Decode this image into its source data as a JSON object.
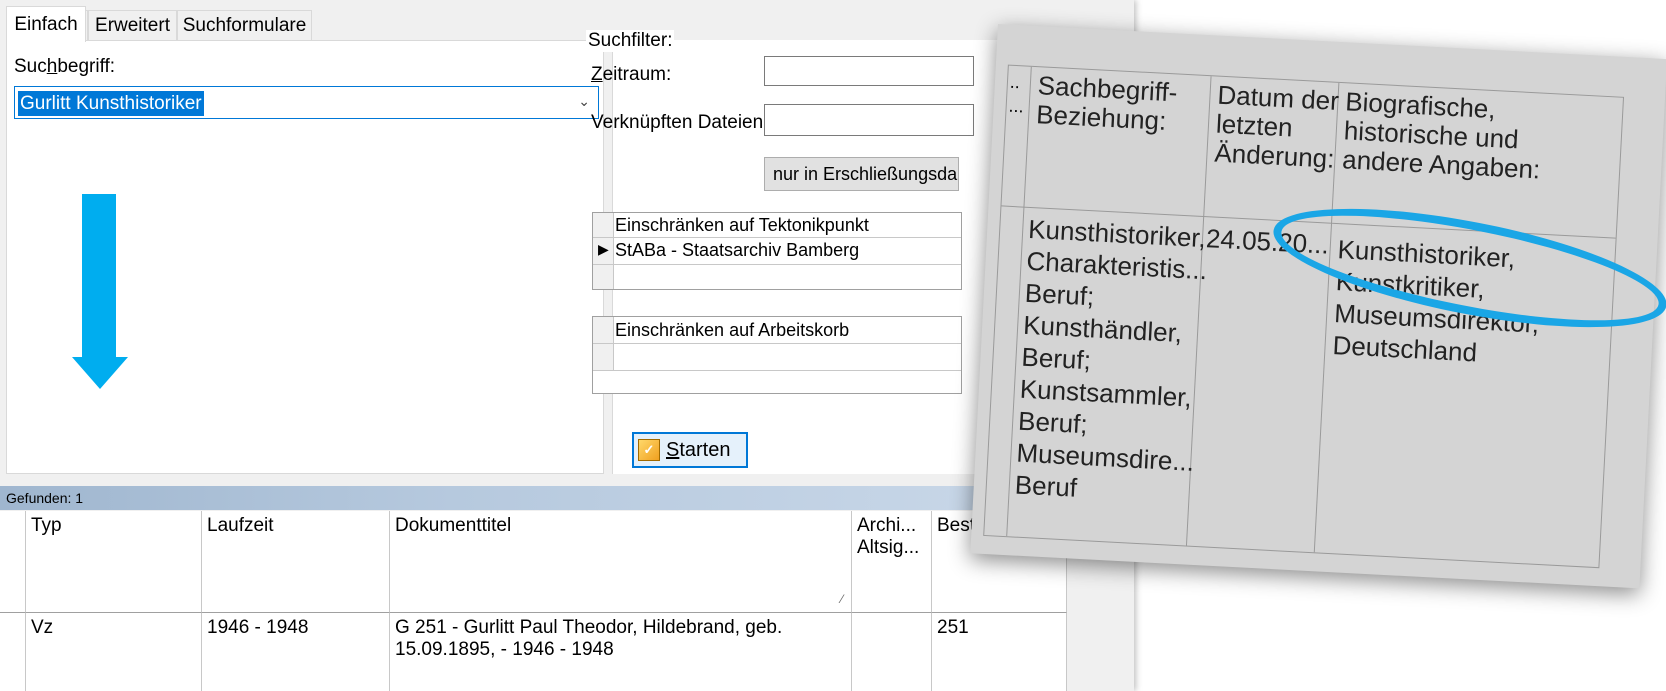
{
  "tabs": [
    "Einfach",
    "Erweitert",
    "Suchformulare"
  ],
  "search": {
    "label_pre": "Suc",
    "label_ul": "h",
    "label_post": "begriff:",
    "value": "Gurlitt Kunsthistoriker"
  },
  "filter": {
    "group_title": "Suchfilter:",
    "zeitraum_ul": "Z",
    "zeitraum_rest": "eitraum:",
    "dateien_label": "Verknüpften Dateien",
    "erschliessung_button": "nur in Erschließungsda",
    "tektonik_header": "Einschränken auf Tektonikpunkt",
    "tektonik_value": "StABa - Staatsarchiv Bamberg",
    "arbeitskorb_header": "Einschränken auf Arbeitskorb",
    "start_ul": "S",
    "start_rest": "tarten"
  },
  "results": {
    "found_label": "Gefunden: 1",
    "columns": [
      "Typ",
      "Laufzeit",
      "Dokumenttitel",
      "Archi...\nAltsig...",
      "Bestellnr..."
    ],
    "rows": [
      {
        "typ": "Vz",
        "laufzeit": "1946 - 1948",
        "titel": "G 251 - Gurlitt Paul Theodor, Hildebrand, geb. 15.09.1895, - 1946 - 1948",
        "archiv": "",
        "bestell": "251"
      }
    ]
  },
  "zoom": {
    "headers": {
      "sachbegriff": "Sachbegriff-\nBeziehung:",
      "datum": "Datum der\nletzten\nÄnderung:",
      "bio": "Biografische,\nhistorische und\nandere Angaben:"
    },
    "cells": {
      "sachbegriff": "Kunsthistoriker,\nCharakteristis...\nBeruf;\nKunsthändler,\nBeruf;\nKunstsammler,\nBeruf;\nMuseumsdire...\nBeruf",
      "datum": "24.05.20...",
      "bio": "Kunsthistoriker,\nKunstkritiker,\nMuseumsdirektor,\nDeutschland"
    },
    "highlight_color": "#1aa6e6"
  },
  "colors": {
    "arrow": "#00adef",
    "selection": "#0078d7"
  }
}
